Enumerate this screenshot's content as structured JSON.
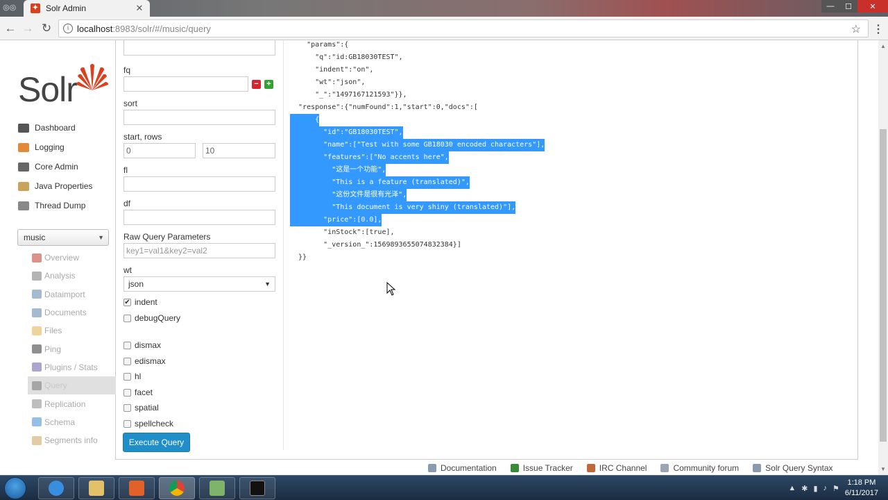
{
  "browser": {
    "tab_title": "Solr Admin",
    "url_host": "localhost",
    "url_path": ":8983/solr/#/music/query"
  },
  "logo_text": "Solr",
  "main_nav": [
    {
      "label": "Dashboard",
      "icon": "dashboard-icon",
      "color": "#555555"
    },
    {
      "label": "Logging",
      "icon": "logging-icon",
      "color": "#e08a3c"
    },
    {
      "label": "Core Admin",
      "icon": "core-admin-icon",
      "color": "#666666"
    },
    {
      "label": "Java Properties",
      "icon": "java-icon",
      "color": "#c9a35a"
    },
    {
      "label": "Thread Dump",
      "icon": "thread-dump-icon",
      "color": "#888888"
    }
  ],
  "core_selector": {
    "value": "music"
  },
  "core_nav": [
    {
      "label": "Overview",
      "icon": "home-icon",
      "color": "#c0392b"
    },
    {
      "label": "Analysis",
      "icon": "filter-icon",
      "color": "#777777"
    },
    {
      "label": "Dataimport",
      "icon": "dataimport-icon",
      "color": "#5b7fa8"
    },
    {
      "label": "Documents",
      "icon": "documents-icon",
      "color": "#5b7fa8"
    },
    {
      "label": "Files",
      "icon": "folder-icon",
      "color": "#e0b04a"
    },
    {
      "label": "Ping",
      "icon": "ping-icon",
      "color": "#333333"
    },
    {
      "label": "Plugins / Stats",
      "icon": "plugins-icon",
      "color": "#6a5aa8"
    },
    {
      "label": "Query",
      "icon": "search-icon",
      "color": "#777777"
    },
    {
      "label": "Replication",
      "icon": "replication-icon",
      "color": "#888888"
    },
    {
      "label": "Schema",
      "icon": "schema-icon",
      "color": "#3e8ad6"
    },
    {
      "label": "Segments info",
      "icon": "segments-icon",
      "color": "#c9a35a"
    }
  ],
  "form": {
    "fq_label": "fq",
    "sort_label": "sort",
    "start_rows_label": "start, rows",
    "start_value": "0",
    "rows_value": "10",
    "fl_label": "fl",
    "df_label": "df",
    "raw_label": "Raw Query Parameters",
    "raw_placeholder": "key1=val1&key2=val2",
    "wt_label": "wt",
    "wt_value": "json",
    "checks": [
      {
        "label": "indent",
        "checked": true
      },
      {
        "label": "debugQuery",
        "checked": false
      },
      {
        "label": "dismax",
        "checked": false
      },
      {
        "label": "edismax",
        "checked": false
      },
      {
        "label": "hl",
        "checked": false
      },
      {
        "label": "facet",
        "checked": false
      },
      {
        "label": "spatial",
        "checked": false
      },
      {
        "label": "spellcheck",
        "checked": false
      }
    ],
    "execute_label": "Execute Query"
  },
  "json_lines": [
    {
      "text": "    \"params\":{",
      "sel": false
    },
    {
      "text": "      \"q\":\"id:GB18030TEST\",",
      "sel": false
    },
    {
      "text": "      \"indent\":\"on\",",
      "sel": false
    },
    {
      "text": "      \"wt\":\"json\",",
      "sel": false
    },
    {
      "text": "      \"_\":\"1497167121593\"}},",
      "sel": false
    },
    {
      "text": "  \"response\":{\"numFound\":1,\"start\":0,\"docs\":[",
      "sel": false
    },
    {
      "text": "      {",
      "sel": true
    },
    {
      "text": "        \"id\":\"GB18030TEST\",",
      "sel": true
    },
    {
      "text": "        \"name\":[\"Test with some GB18030 encoded characters\"],",
      "sel": true
    },
    {
      "text": "        \"features\":[\"No accents here\",",
      "sel": true
    },
    {
      "text": "          \"这是一个功能\",",
      "sel": true
    },
    {
      "text": "          \"This is a feature (translated)\",",
      "sel": true
    },
    {
      "text": "          \"这份文件是很有光泽\",",
      "sel": true
    },
    {
      "text": "          \"This document is very shiny (translated)\"],",
      "sel": true
    },
    {
      "text": "        \"price\":[0.0],",
      "sel": true
    },
    {
      "text": "        \"inStock\":[true],",
      "sel": false
    },
    {
      "text": "        \"_version_\":1569893655074832384}]",
      "sel": false
    },
    {
      "text": "  }}",
      "sel": false
    }
  ],
  "footer": [
    {
      "label": "Documentation",
      "icon": "documentation-icon",
      "color": "#8a9bb0"
    },
    {
      "label": "Issue Tracker",
      "icon": "bug-icon",
      "color": "#3a8a3a"
    },
    {
      "label": "IRC Channel",
      "icon": "irc-icon",
      "color": "#c0683a"
    },
    {
      "label": "Community forum",
      "icon": "mail-icon",
      "color": "#9aa5b5"
    },
    {
      "label": "Solr Query Syntax",
      "icon": "query-syntax-icon",
      "color": "#8a9bb0"
    }
  ],
  "taskbar": {
    "time": "1:18 PM",
    "date": "6/11/2017"
  },
  "colors": {
    "accent_button": "#1f8ec9",
    "selection": "#3399ff",
    "solr_red": "#d9411e"
  }
}
